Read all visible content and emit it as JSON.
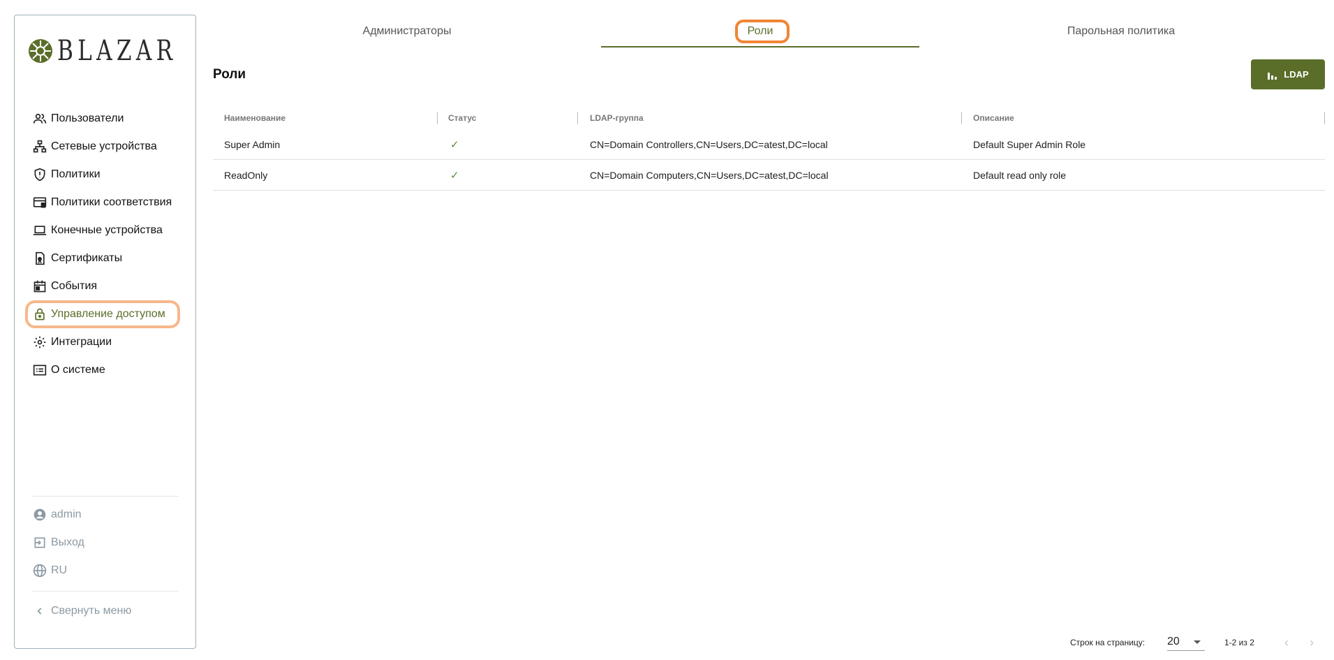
{
  "brand": {
    "name": "BLAZAR",
    "accent": "#5a6e2a",
    "highlight": "#f08535"
  },
  "sidebar": {
    "items": [
      {
        "label": "Пользователи",
        "icon": "users-icon"
      },
      {
        "label": "Сетевые устройства",
        "icon": "network-icon"
      },
      {
        "label": "Политики",
        "icon": "shield-alert-icon"
      },
      {
        "label": "Политики соответствия",
        "icon": "card-compliance-icon"
      },
      {
        "label": "Конечные устройства",
        "icon": "laptop-icon"
      },
      {
        "label": "Сертификаты",
        "icon": "certificate-icon"
      },
      {
        "label": "События",
        "icon": "calendar-icon"
      },
      {
        "label": "Управление доступом",
        "icon": "lock-icon",
        "active": true
      },
      {
        "label": "Интеграции",
        "icon": "gear-icon"
      },
      {
        "label": "О системе",
        "icon": "info-card-icon"
      }
    ],
    "user": {
      "label": "admin",
      "icon": "account-circle-icon"
    },
    "logout": {
      "label": "Выход",
      "icon": "logout-icon"
    },
    "language": {
      "label": "RU",
      "icon": "globe-icon"
    },
    "collapse": {
      "label": "Свернуть меню",
      "icon": "chevron-left-icon"
    }
  },
  "tabs": [
    {
      "label": "Администраторы"
    },
    {
      "label": "Роли",
      "active": true
    },
    {
      "label": "Парольная политика"
    }
  ],
  "page": {
    "title": "Роли",
    "ldap_button": "LDAP"
  },
  "table": {
    "columns": [
      "Наименование",
      "Статус",
      "LDAP-группа",
      "Описание"
    ],
    "rows": [
      {
        "name": "Super Admin",
        "status": "✓",
        "ldap": "CN=Domain Controllers,CN=Users,DC=atest,DC=local",
        "description": "Default Super Admin Role"
      },
      {
        "name": "ReadOnly",
        "status": "✓",
        "ldap": "CN=Domain Computers,CN=Users,DC=atest,DC=local",
        "description": "Default read only role"
      }
    ]
  },
  "pagination": {
    "rows_per_page_label": "Строк на страницу:",
    "rows_per_page": "20",
    "range": "1-2 из 2",
    "prev": "‹",
    "next": "›"
  }
}
